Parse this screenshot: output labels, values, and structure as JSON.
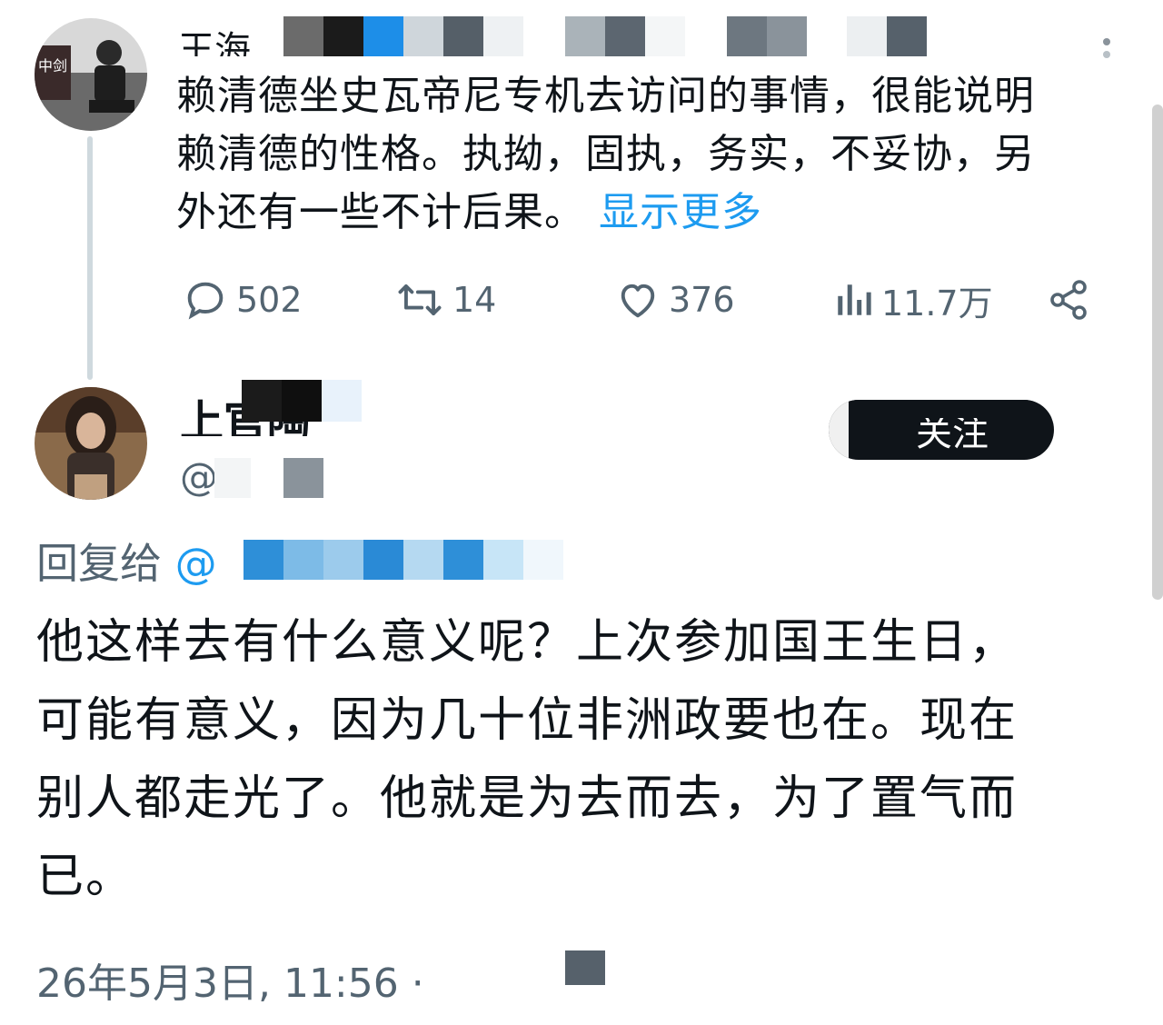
{
  "colors": {
    "accent": "#1d9bf0",
    "muted": "#536471",
    "text": "#0f1419",
    "thread": "#cfd9de"
  },
  "parent": {
    "avatar": "avatar-photo",
    "name_partial": "王海",
    "more_icon": "more-vertical-icon",
    "text": "赖清德坐史瓦帝尼专机去访问的事情，很能说明赖清德的性格。执拗，固执，务实，不妥协，另外还有一些不计后果。",
    "line1": "赖清德坐史瓦帝尼专机去访问的事情，很能说明",
    "line2": "赖清德的性格。执拗，固执，务实，不妥协，另",
    "line3": "外还有一些不计后果。",
    "show_more": "显示更多",
    "actions": {
      "reply_count": "502",
      "retweet_count": "14",
      "like_count": "376",
      "view_count": "11.7万"
    }
  },
  "reply": {
    "avatar": "avatar-photo",
    "name_partial": "上官陶",
    "handle_partial": "@",
    "follow_label": "关注",
    "reply_to_label": "回复给",
    "reply_to_handle": "@",
    "line1": "他这样去有什么意义呢？上次参加国王生日，",
    "line2": "可能有意义，因为几十位非洲政要也在。现在",
    "line3": "别人都走光了。他就是为去而去，为了置气而",
    "line4": "已。",
    "timestamp": "26年5月3日, 11:56 ·"
  }
}
